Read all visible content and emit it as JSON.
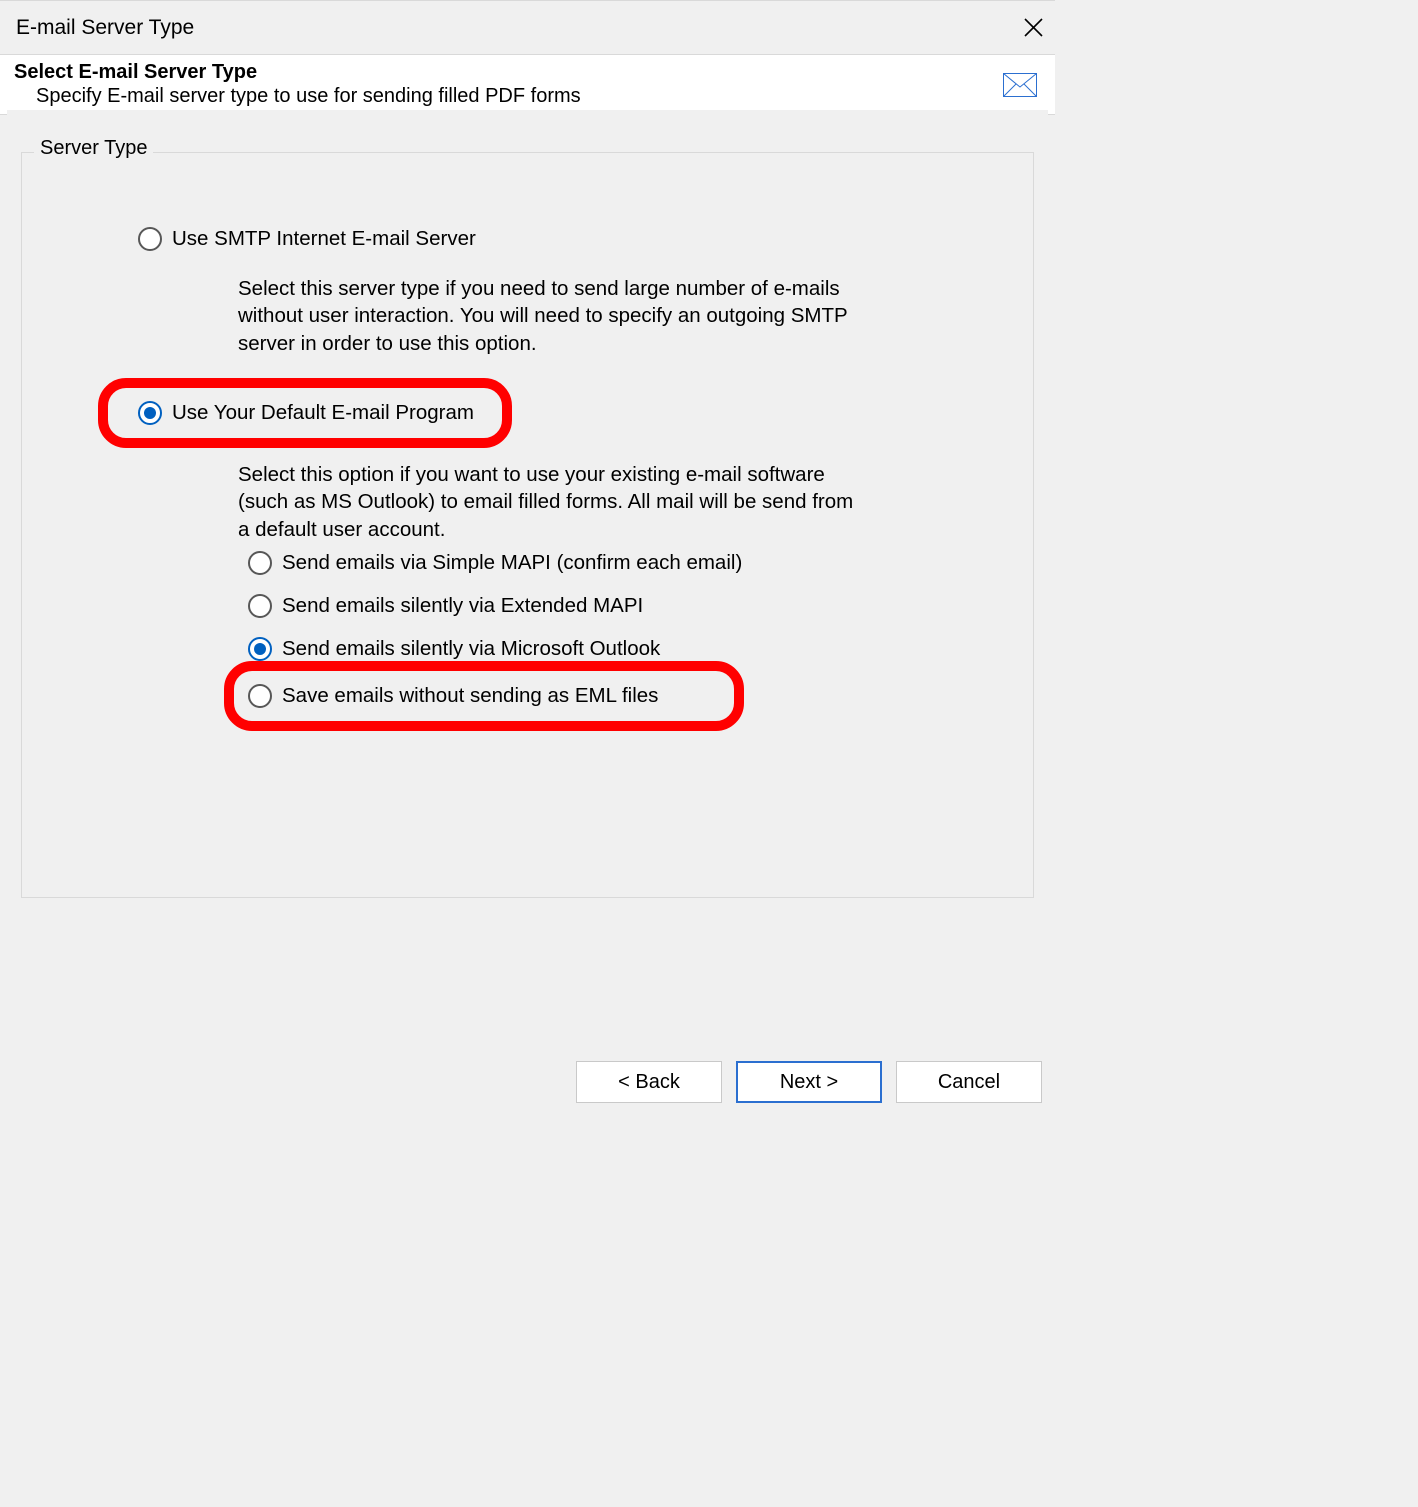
{
  "window": {
    "title": "E-mail Server Type"
  },
  "header": {
    "title": "Select E-mail Server Type",
    "subtitle": "Specify E-mail server type to use for sending filled PDF forms"
  },
  "group": {
    "legend": "Server Type"
  },
  "options": {
    "smtp": {
      "label": "Use SMTP Internet E-mail Server",
      "desc": "Select this server type if you need to send large number of e-mails without user interaction. You will need to specify an outgoing SMTP server in order to use this option.",
      "checked": false
    },
    "defaultClient": {
      "label": "Use Your Default E-mail Program",
      "desc": "Select this option if you want to use your existing e-mail software (such as MS Outlook) to email filled forms. All mail will be send from a default user account.",
      "checked": true
    },
    "sub": {
      "simpleMapi": {
        "label": "Send emails via Simple MAPI (confirm each email)",
        "checked": false
      },
      "extMapi": {
        "label": "Send emails silently via Extended MAPI",
        "checked": false
      },
      "outlook": {
        "label": "Send emails silently via Microsoft Outlook",
        "checked": true
      },
      "eml": {
        "label": "Save emails without sending as EML files",
        "checked": false
      }
    }
  },
  "buttons": {
    "back": "< Back",
    "next": "Next >",
    "cancel": "Cancel"
  }
}
